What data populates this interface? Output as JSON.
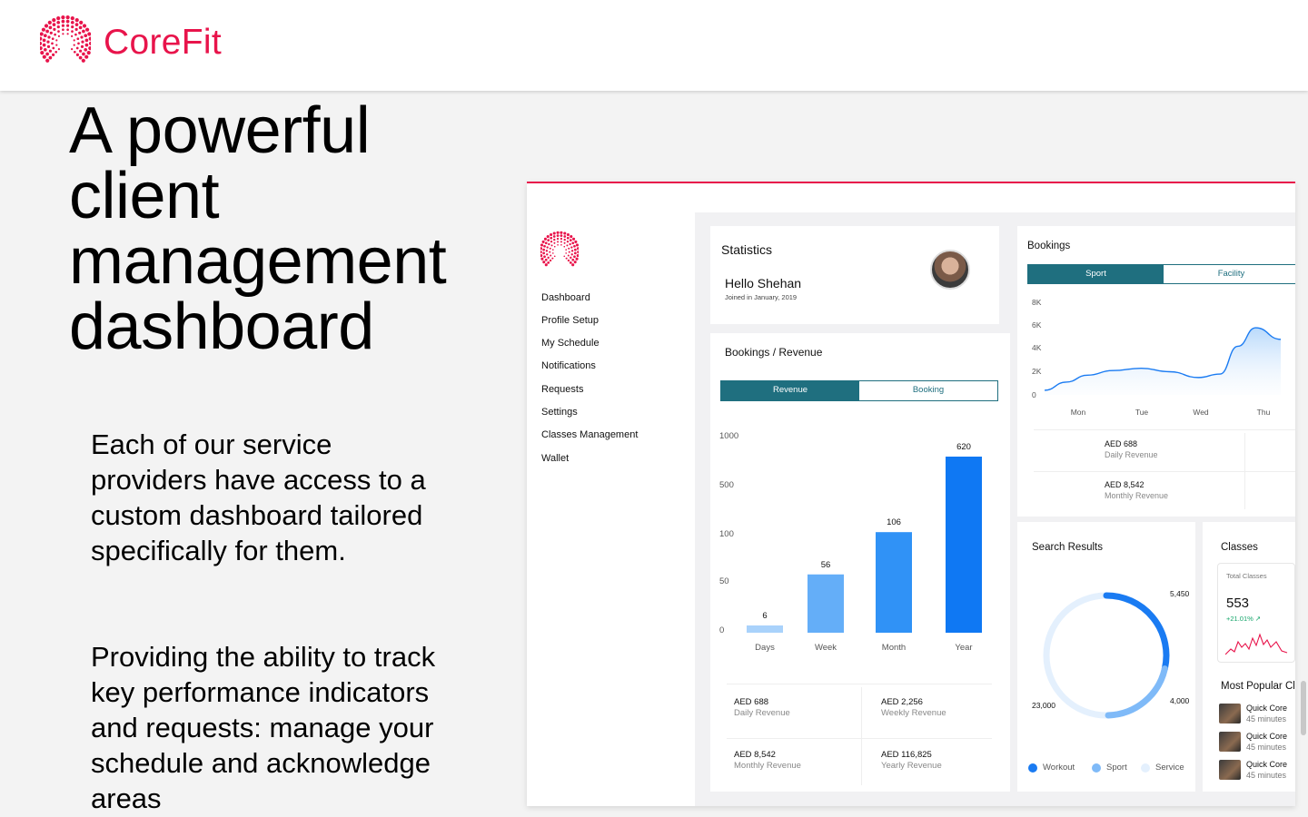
{
  "brand": {
    "name": "CoreFit",
    "color": "#e8144b"
  },
  "hero": {
    "headline": "A powerful client management dashboard",
    "paragraph1": "Each of our service providers have access to a custom dashboard tailored specifically for them.",
    "paragraph2": "Providing the ability to track key performance indicators and requests: manage your schedule and acknowledge areas"
  },
  "sidebar": {
    "items": [
      "Dashboard",
      "Profile Setup",
      "My Schedule",
      "Notifications",
      "Requests",
      "Settings",
      "Classes Management",
      "Wallet"
    ]
  },
  "statistics": {
    "title": "Statistics",
    "greeting": "Hello Shehan",
    "joined": "Joined in January, 2019"
  },
  "bookings_revenue": {
    "title": "Bookings / Revenue",
    "tabs": [
      "Revenue",
      "Booking"
    ],
    "active_tab": "Revenue",
    "summaries": [
      {
        "value": "AED 688",
        "label": "Daily Revenue"
      },
      {
        "value": "AED 2,256",
        "label": "Weekly Revenue"
      },
      {
        "value": "AED 8,542",
        "label": "Monthly Revenue"
      },
      {
        "value": "AED 116,825",
        "label": "Yearly Revenue"
      }
    ]
  },
  "bookings": {
    "title": "Bookings",
    "tabs": [
      "Sport",
      "Facility"
    ],
    "active_tab": "Sport",
    "summaries": [
      {
        "value": "AED 688",
        "label": "Daily Revenue"
      },
      {
        "value": "AED 8,542",
        "label": "Monthly Revenue"
      }
    ]
  },
  "search_results": {
    "title": "Search Results",
    "labels": [
      "5,450",
      "4,000",
      "23,000"
    ],
    "legend": [
      "Workout",
      "Sport",
      "Service"
    ]
  },
  "classes": {
    "title": "Classes",
    "total_label": "Total Classes",
    "total_value": "553",
    "change": "+21.01%",
    "popular_title": "Most Popular Cl",
    "popular": [
      {
        "name": "Quick Core",
        "duration": "45 minutes"
      },
      {
        "name": "Quick Core",
        "duration": "45 minutes"
      },
      {
        "name": "Quick Core",
        "duration": "45 minutes"
      }
    ]
  },
  "colors": {
    "accent": "#e8144b",
    "teal": "#1f6f7f",
    "blue": "#1a7bf2",
    "light_blue": "#7fbaf8",
    "green": "#16a66b"
  },
  "chart_data": [
    {
      "type": "bar",
      "categories": [
        "Days",
        "Week",
        "Month",
        "Year"
      ],
      "values": [
        6,
        56,
        106,
        620
      ],
      "y_ticks": [
        "1000",
        "500",
        "100",
        "50",
        "0"
      ],
      "colors": [
        "#a9d2fb",
        "#64aef8",
        "#3092f6",
        "#0f78f3"
      ]
    },
    {
      "type": "area",
      "categories": [
        "Mon",
        "Tue",
        "Wed",
        "Thu"
      ],
      "y_ticks": [
        "8K",
        "6K",
        "4K",
        "2K",
        "0"
      ],
      "ylim": [
        0,
        8000
      ],
      "x": [
        0,
        0.3,
        0.6,
        0.95,
        1.35,
        1.75,
        2.15,
        2.45,
        2.7,
        2.95,
        3.3
      ],
      "values": [
        400,
        1100,
        1700,
        2100,
        2300,
        2000,
        1500,
        1800,
        4200,
        5800,
        4800
      ]
    },
    {
      "type": "pie",
      "labels": [
        "5,450",
        "4,000",
        "23,000"
      ],
      "series": [
        "Workout",
        "Sport",
        "Service"
      ],
      "values": [
        5450,
        4000,
        23000
      ],
      "colors": [
        "#1a7bf2",
        "#7fbaf8",
        "#e4f0fd"
      ]
    }
  ]
}
